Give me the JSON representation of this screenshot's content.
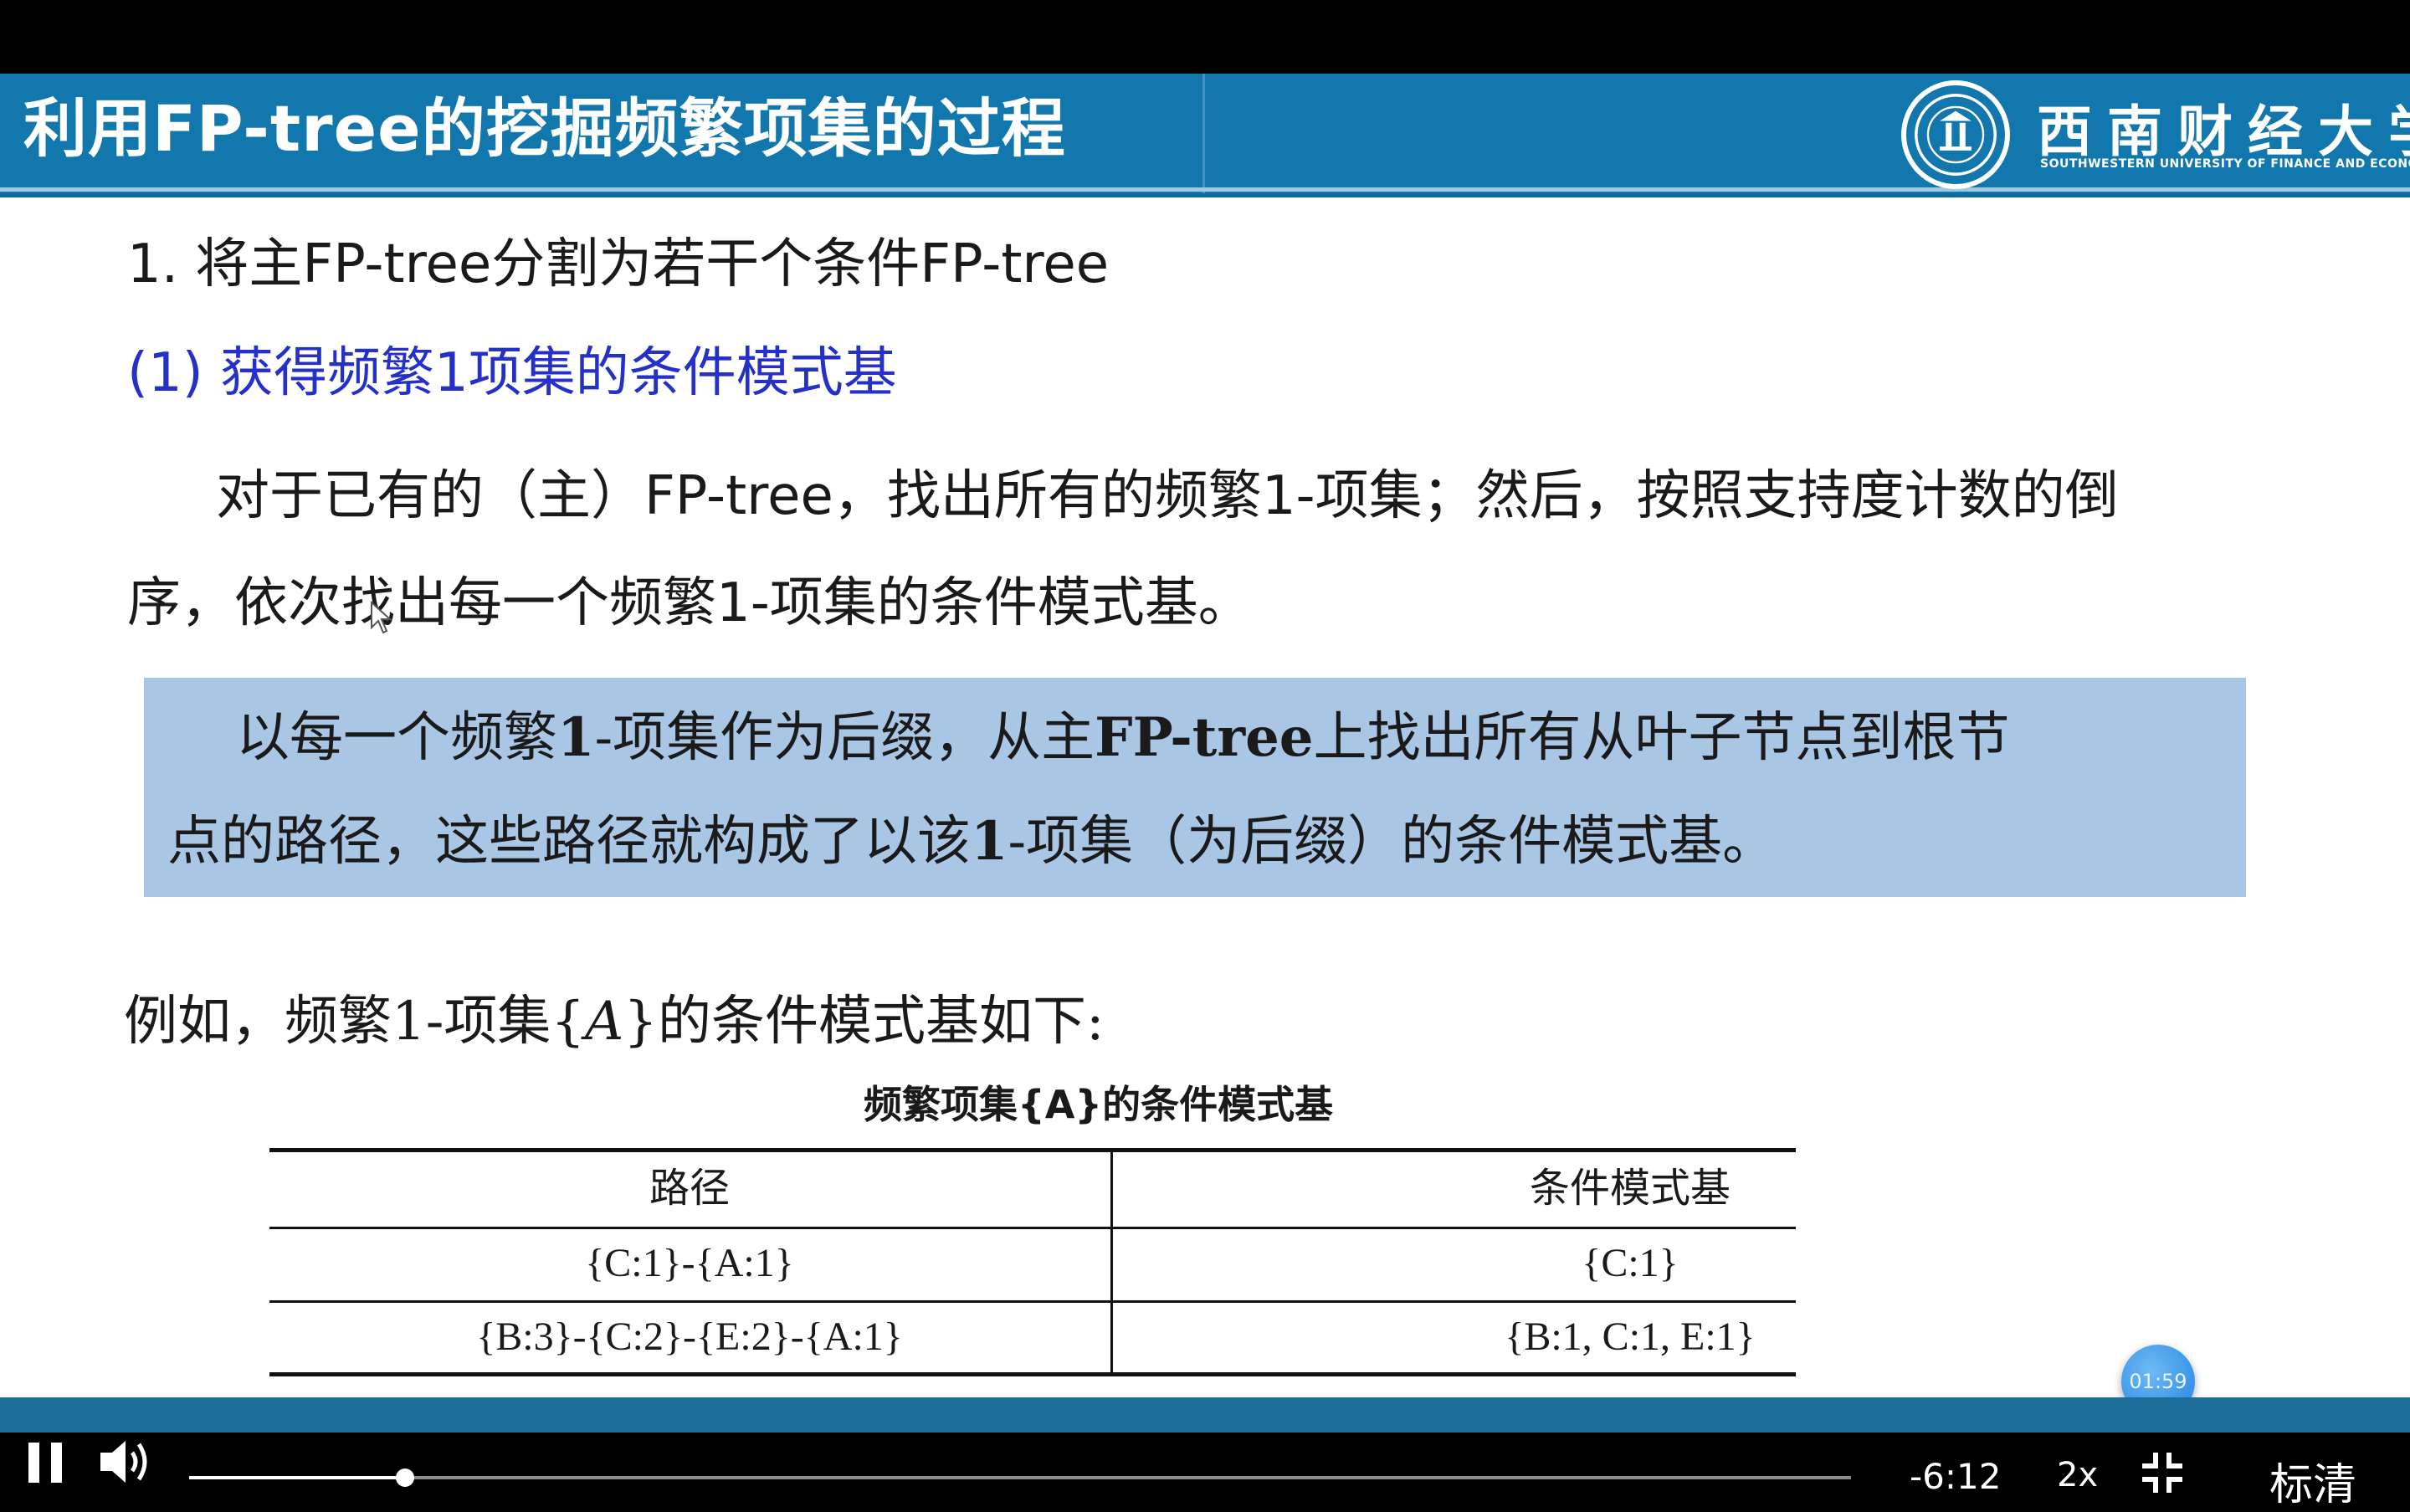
{
  "slide": {
    "title": "利用FP-tree的挖掘频繁项集的过程",
    "logo": {
      "chinese_name": "西南财经大学",
      "english_name": "SOUTHWESTERN UNIVERSITY OF FINANCE AND ECONOMICS"
    },
    "heading1": "1. 将主FP-tree分割为若干个条件FP-tree",
    "heading2": "(1) 获得频繁1项集的条件模式基",
    "body_line1": "对于已有的（主）FP-tree，找出所有的频繁1-项集；然后，按照支持度计数的倒",
    "body_line2": "序，依次找出每一个频繁1-项集的条件模式基。",
    "highlight": {
      "line1_a": "以每一个频繁",
      "line1_b": "1",
      "line1_c": "-项集作为后缀，从主",
      "line1_d": "FP-tree",
      "line1_e": "上找出所有从叶子节点到根节",
      "line2_a": "点的路径，这些路径就构成了以该",
      "line2_b": "1",
      "line2_c": "-项集（为后缀）的条件模式基。"
    },
    "example": {
      "prefix": "例如，频繁1-项集{",
      "item": "A",
      "suffix": "}的条件模式基如下:"
    },
    "table": {
      "caption": "频繁项集{A}的条件模式基",
      "headers": [
        "路径",
        "条件模式基"
      ],
      "rows": [
        [
          "{C:1}-{A:1}",
          "{C:1}"
        ],
        [
          "{B:3}-{C:2}-{E:2}-{A:1}",
          "{B:1, C:1, E:1}"
        ]
      ]
    }
  },
  "player": {
    "timer_bubble": "01:59",
    "time_remaining": "-6:12",
    "speed": "2x",
    "quality": "标清",
    "progress_fraction": 0.13,
    "icons": [
      "pause-icon",
      "volume-icon",
      "fullscreen-exit-icon",
      "cursor-icon"
    ]
  },
  "colors": {
    "header": "#1277ad",
    "heading2": "#2430c8",
    "highlight": "#a9c6e4",
    "progress": "#ffffff"
  }
}
